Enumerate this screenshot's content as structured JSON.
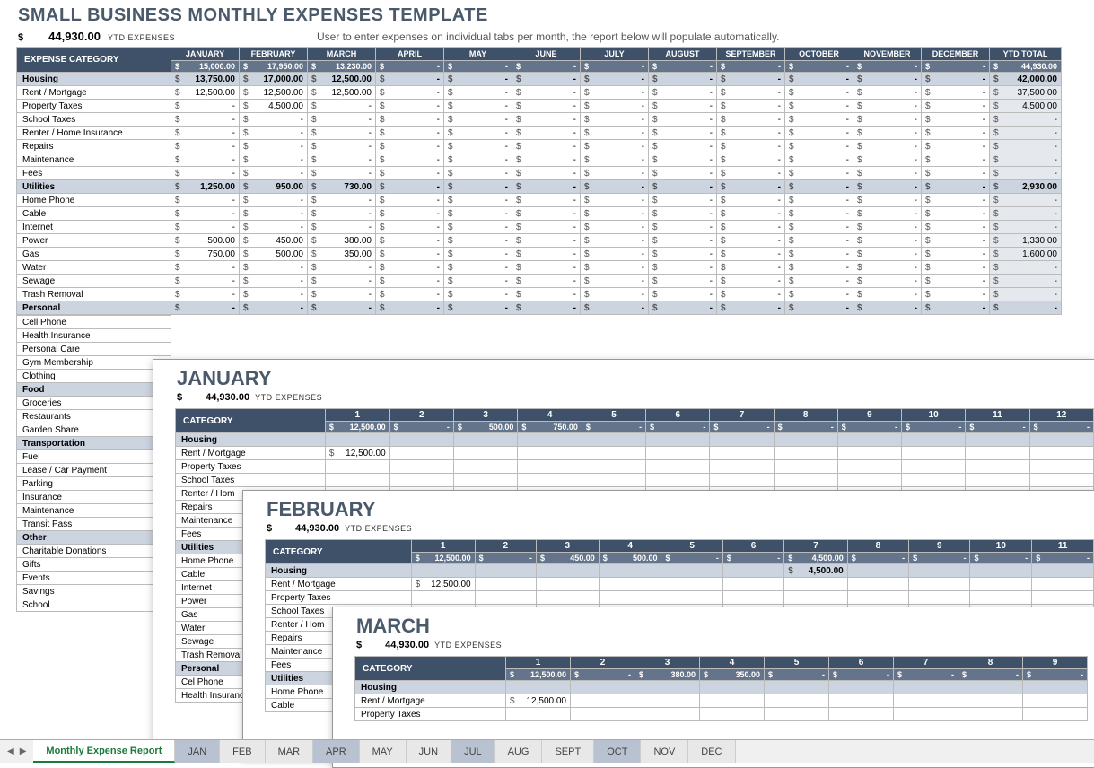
{
  "title": "SMALL BUSINESS MONTHLY EXPENSES TEMPLATE",
  "ytd_currency": "$",
  "ytd_amount": "44,930.00",
  "ytd_label": "YTD EXPENSES",
  "instruction": "User to enter expenses on individual tabs per month, the report below will populate automatically.",
  "header": {
    "cat_label": "EXPENSE CATEGORY",
    "ytd_total": "YTD TOTAL",
    "months": [
      "JANUARY",
      "FEBRUARY",
      "MARCH",
      "APRIL",
      "MAY",
      "JUNE",
      "JULY",
      "AUGUST",
      "SEPTEMBER",
      "OCTOBER",
      "NOVEMBER",
      "DECEMBER"
    ],
    "totals": [
      "15,000.00",
      "17,950.00",
      "13,230.00",
      "-",
      "-",
      "-",
      "-",
      "-",
      "-",
      "-",
      "-",
      "-"
    ],
    "ytd_total_val": "44,930.00"
  },
  "rows": [
    {
      "group": true,
      "label": "Housing",
      "vals": [
        "13,750.00",
        "17,000.00",
        "12,500.00",
        "-",
        "-",
        "-",
        "-",
        "-",
        "-",
        "-",
        "-",
        "-"
      ],
      "ytd": "42,000.00"
    },
    {
      "label": "Rent / Mortgage",
      "vals": [
        "12,500.00",
        "12,500.00",
        "12,500.00",
        "-",
        "-",
        "-",
        "-",
        "-",
        "-",
        "-",
        "-",
        "-"
      ],
      "ytd": "37,500.00"
    },
    {
      "label": "Property Taxes",
      "vals": [
        "-",
        "4,500.00",
        "-",
        "-",
        "-",
        "-",
        "-",
        "-",
        "-",
        "-",
        "-",
        "-"
      ],
      "ytd": "4,500.00"
    },
    {
      "label": "School Taxes",
      "vals": [
        "-",
        "-",
        "-",
        "-",
        "-",
        "-",
        "-",
        "-",
        "-",
        "-",
        "-",
        "-"
      ],
      "ytd": "-"
    },
    {
      "label": "Renter / Home Insurance",
      "vals": [
        "-",
        "-",
        "-",
        "-",
        "-",
        "-",
        "-",
        "-",
        "-",
        "-",
        "-",
        "-"
      ],
      "ytd": "-"
    },
    {
      "label": "Repairs",
      "vals": [
        "-",
        "-",
        "-",
        "-",
        "-",
        "-",
        "-",
        "-",
        "-",
        "-",
        "-",
        "-"
      ],
      "ytd": "-"
    },
    {
      "label": "Maintenance",
      "vals": [
        "-",
        "-",
        "-",
        "-",
        "-",
        "-",
        "-",
        "-",
        "-",
        "-",
        "-",
        "-"
      ],
      "ytd": "-"
    },
    {
      "label": "Fees",
      "vals": [
        "-",
        "-",
        "-",
        "-",
        "-",
        "-",
        "-",
        "-",
        "-",
        "-",
        "-",
        "-"
      ],
      "ytd": "-"
    },
    {
      "group": true,
      "label": "Utilities",
      "vals": [
        "1,250.00",
        "950.00",
        "730.00",
        "-",
        "-",
        "-",
        "-",
        "-",
        "-",
        "-",
        "-",
        "-"
      ],
      "ytd": "2,930.00"
    },
    {
      "label": "Home Phone",
      "vals": [
        "-",
        "-",
        "-",
        "-",
        "-",
        "-",
        "-",
        "-",
        "-",
        "-",
        "-",
        "-"
      ],
      "ytd": "-"
    },
    {
      "label": "Cable",
      "vals": [
        "-",
        "-",
        "-",
        "-",
        "-",
        "-",
        "-",
        "-",
        "-",
        "-",
        "-",
        "-"
      ],
      "ytd": "-"
    },
    {
      "label": "Internet",
      "vals": [
        "-",
        "-",
        "-",
        "-",
        "-",
        "-",
        "-",
        "-",
        "-",
        "-",
        "-",
        "-"
      ],
      "ytd": "-"
    },
    {
      "label": "Power",
      "vals": [
        "500.00",
        "450.00",
        "380.00",
        "-",
        "-",
        "-",
        "-",
        "-",
        "-",
        "-",
        "-",
        "-"
      ],
      "ytd": "1,330.00"
    },
    {
      "label": "Gas",
      "vals": [
        "750.00",
        "500.00",
        "350.00",
        "-",
        "-",
        "-",
        "-",
        "-",
        "-",
        "-",
        "-",
        "-"
      ],
      "ytd": "1,600.00"
    },
    {
      "label": "Water",
      "vals": [
        "-",
        "-",
        "-",
        "-",
        "-",
        "-",
        "-",
        "-",
        "-",
        "-",
        "-",
        "-"
      ],
      "ytd": "-"
    },
    {
      "label": "Sewage",
      "vals": [
        "-",
        "-",
        "-",
        "-",
        "-",
        "-",
        "-",
        "-",
        "-",
        "-",
        "-",
        "-"
      ],
      "ytd": "-"
    },
    {
      "label": "Trash Removal",
      "vals": [
        "-",
        "-",
        "-",
        "-",
        "-",
        "-",
        "-",
        "-",
        "-",
        "-",
        "-",
        "-"
      ],
      "ytd": "-"
    },
    {
      "group": true,
      "label": "Personal",
      "vals": [
        "-",
        "-",
        "-",
        "-",
        "-",
        "-",
        "-",
        "-",
        "-",
        "-",
        "-",
        "-"
      ],
      "ytd": "-"
    }
  ],
  "cat_only": [
    "Cell Phone",
    "Health Insurance",
    "Personal Care",
    "Gym Membership",
    "Clothing",
    {
      "g": true,
      "l": "Food"
    },
    "Groceries",
    "Restaurants",
    "Garden Share",
    {
      "g": true,
      "l": "Transportation"
    },
    "Fuel",
    "Lease / Car Payment",
    "Parking",
    "Insurance",
    "Maintenance",
    "Transit Pass",
    {
      "g": true,
      "l": "Other"
    },
    "Charitable Donations",
    "Gifts",
    "Events",
    "Savings",
    "School"
  ],
  "overlays": {
    "jan": {
      "title": "JANUARY",
      "ytd": "44,930.00",
      "cat_label": "CATEGORY",
      "days": [
        "1",
        "2",
        "3",
        "4",
        "5",
        "6",
        "7",
        "8",
        "9",
        "10",
        "11",
        "12"
      ],
      "totals": [
        "12,500.00",
        "-",
        "500.00",
        "750.00",
        "-",
        "-",
        "-",
        "-",
        "-",
        "-",
        "-",
        "-"
      ],
      "rows": [
        {
          "g": true,
          "l": "Housing",
          "v": [
            "",
            "",
            "",
            "",
            "",
            "",
            "",
            "",
            "",
            "",
            "",
            ""
          ]
        },
        {
          "l": "Rent / Mortgage",
          "v": [
            "12,500.00",
            "",
            "",
            "",
            "",
            "",
            "",
            "",
            "",
            "",
            "",
            ""
          ]
        },
        {
          "l": "Property Taxes",
          "v": [
            "",
            "",
            "",
            "",
            "",
            "",
            "",
            "",
            "",
            "",
            "",
            ""
          ]
        },
        {
          "l": "School Taxes",
          "v": [
            "",
            "",
            "",
            "",
            "",
            "",
            "",
            "",
            "",
            "",
            "",
            ""
          ]
        },
        {
          "l": "Renter / Hom",
          "v": [
            "",
            "",
            "",
            "",
            "",
            "",
            "",
            "",
            "",
            "",
            "",
            ""
          ]
        },
        {
          "l": "Repairs",
          "v": [
            "",
            "",
            "",
            "",
            "",
            "",
            "",
            "",
            "",
            "",
            "",
            ""
          ]
        },
        {
          "l": "Maintenance",
          "v": [
            "",
            "",
            "",
            "",
            "",
            "",
            "",
            "",
            "",
            "",
            "",
            ""
          ]
        },
        {
          "l": "Fees",
          "v": [
            "",
            "",
            "",
            "",
            "",
            "",
            "",
            "",
            "",
            "",
            "",
            ""
          ]
        },
        {
          "g": true,
          "l": "Utilities",
          "v": [
            "",
            "",
            "",
            "",
            "",
            "",
            "",
            "",
            "",
            "",
            "",
            ""
          ]
        },
        {
          "l": "Home Phone",
          "v": [
            "",
            "",
            "",
            "",
            "",
            "",
            "",
            "",
            "",
            "",
            "",
            ""
          ]
        },
        {
          "l": "Cable",
          "v": [
            "",
            "",
            "",
            "",
            "",
            "",
            "",
            "",
            "",
            "",
            "",
            ""
          ]
        },
        {
          "l": "Internet",
          "v": [
            "",
            "",
            "",
            "",
            "",
            "",
            "",
            "",
            "",
            "",
            "",
            ""
          ]
        },
        {
          "l": "Power",
          "v": [
            "",
            "",
            "",
            "",
            "",
            "",
            "",
            "",
            "",
            "",
            "",
            ""
          ]
        },
        {
          "l": "Gas",
          "v": [
            "",
            "",
            "",
            "",
            "",
            "",
            "",
            "",
            "",
            "",
            "",
            ""
          ]
        },
        {
          "l": "Water",
          "v": [
            "",
            "",
            "",
            "",
            "",
            "",
            "",
            "",
            "",
            "",
            "",
            ""
          ]
        },
        {
          "l": "Sewage",
          "v": [
            "",
            "",
            "",
            "",
            "",
            "",
            "",
            "",
            "",
            "",
            "",
            ""
          ]
        },
        {
          "l": "Trash Removal",
          "v": [
            "",
            "",
            "",
            "",
            "",
            "",
            "",
            "",
            "",
            "",
            "",
            ""
          ]
        },
        {
          "g": true,
          "l": "Personal",
          "v": [
            "",
            "",
            "",
            "",
            "",
            "",
            "",
            "",
            "",
            "",
            "",
            ""
          ]
        },
        {
          "l": "Cel Phone",
          "v": [
            "",
            "",
            "",
            "",
            "",
            "",
            "",
            "",
            "",
            "",
            "",
            ""
          ]
        },
        {
          "l": "Health Insurance",
          "v": [
            "",
            "",
            "",
            "",
            "",
            "",
            "",
            "",
            "",
            "",
            "",
            ""
          ]
        }
      ]
    },
    "feb": {
      "title": "FEBRUARY",
      "ytd": "44,930.00",
      "cat_label": "CATEGORY",
      "days": [
        "1",
        "2",
        "3",
        "4",
        "5",
        "6",
        "7",
        "8",
        "9",
        "10",
        "11"
      ],
      "totals": [
        "12,500.00",
        "-",
        "450.00",
        "500.00",
        "-",
        "-",
        "4,500.00",
        "-",
        "-",
        "-",
        "-"
      ],
      "rows": [
        {
          "g": true,
          "l": "Housing",
          "v": [
            "",
            "",
            "",
            "",
            "",
            "",
            "4,500.00",
            "",
            "",
            "",
            ""
          ]
        },
        {
          "l": "Rent / Mortgage",
          "v": [
            "12,500.00",
            "",
            "",
            "",
            "",
            "",
            "",
            "",
            "",
            "",
            ""
          ]
        },
        {
          "l": "Property Taxes",
          "v": [
            "",
            "",
            "",
            "",
            "",
            "",
            "",
            "",
            "",
            "",
            ""
          ]
        },
        {
          "l": "School Taxes",
          "v": [
            "",
            "",
            "",
            "",
            "",
            "",
            "",
            "",
            "",
            "",
            ""
          ]
        },
        {
          "l": "Renter / Hom",
          "v": [
            "",
            "",
            "",
            "",
            "",
            "",
            "",
            "",
            "",
            "",
            ""
          ]
        },
        {
          "l": "Repairs",
          "v": [
            "",
            "",
            "",
            "",
            "",
            "",
            "",
            "",
            "",
            "",
            ""
          ]
        },
        {
          "l": "Maintenance",
          "v": [
            "",
            "",
            "",
            "",
            "",
            "",
            "",
            "",
            "",
            "",
            ""
          ]
        },
        {
          "l": "Fees",
          "v": [
            "",
            "",
            "",
            "",
            "",
            "",
            "",
            "",
            "",
            "",
            ""
          ]
        },
        {
          "g": true,
          "l": "Utilities",
          "v": [
            "",
            "",
            "",
            "",
            "",
            "",
            "",
            "",
            "",
            "",
            ""
          ]
        },
        {
          "l": "Home Phone",
          "v": [
            "",
            "",
            "",
            "",
            "",
            "",
            "",
            "",
            "",
            "",
            ""
          ]
        },
        {
          "l": "Cable",
          "v": [
            "",
            "",
            "",
            "",
            "",
            "",
            "",
            "",
            "",
            "",
            ""
          ]
        }
      ]
    },
    "mar": {
      "title": "MARCH",
      "ytd": "44,930.00",
      "cat_label": "CATEGORY",
      "days": [
        "1",
        "2",
        "3",
        "4",
        "5",
        "6",
        "7",
        "8",
        "9"
      ],
      "totals": [
        "12,500.00",
        "-",
        "380.00",
        "350.00",
        "-",
        "-",
        "-",
        "-",
        "-"
      ],
      "rows": [
        {
          "g": true,
          "l": "Housing",
          "v": [
            "",
            "",
            "",
            "",
            "",
            "",
            "",
            "",
            ""
          ]
        },
        {
          "l": "Rent / Mortgage",
          "v": [
            "12,500.00",
            "",
            "",
            "",
            "",
            "",
            "",
            "",
            ""
          ]
        },
        {
          "l": "Property Taxes",
          "v": [
            "",
            "",
            "",
            "",
            "",
            "",
            "",
            "",
            ""
          ]
        }
      ]
    }
  },
  "tabs": {
    "active": "Monthly Expense Report",
    "items": [
      "JAN",
      "FEB",
      "MAR",
      "APR",
      "MAY",
      "JUN",
      "JUL",
      "AUG",
      "SEPT",
      "OCT",
      "NOV",
      "DEC"
    ],
    "shaded": [
      "JAN",
      "APR",
      "JUL",
      "OCT"
    ]
  }
}
